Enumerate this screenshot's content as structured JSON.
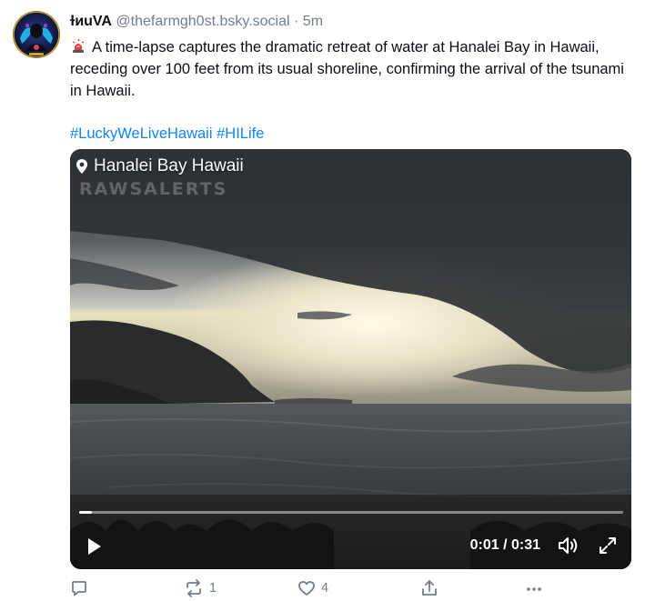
{
  "post": {
    "display_name": "ɫᴎuVA",
    "handle": "@thefarmgh0st.bsky.social",
    "separator": "·",
    "time_ago": "5m",
    "text": "A time-lapse captures the dramatic retreat of water at Hanalei Bay in Hawaii, receding over 100 feet from its usual shoreline, confirming the arrival of the tsunami in Hawaii.",
    "text_icon": "siren-icon",
    "hashtags": [
      "#LuckyWeLiveHawaii",
      "#HILife"
    ]
  },
  "video": {
    "location_label": "Hanalei Bay Hawaii",
    "location_icon": "map-pin-icon",
    "watermark": "RAWSALERTS",
    "time_display": "0:01 / 0:31",
    "progress_fraction": 0.023,
    "controls": {
      "play_icon": "play-icon",
      "mute_icon": "volume-icon",
      "fullscreen_icon": "fullscreen-icon"
    }
  },
  "actions": {
    "reply_icon": "reply-icon",
    "reply_count": "",
    "repost_icon": "repost-icon",
    "repost_count": "1",
    "like_icon": "heart-icon",
    "like_count": "4",
    "share_icon": "share-icon",
    "more_icon": "more-icon"
  },
  "colors": {
    "link": "#1083fe",
    "muted": "#6f7f8f",
    "text": "#0b0f14"
  }
}
